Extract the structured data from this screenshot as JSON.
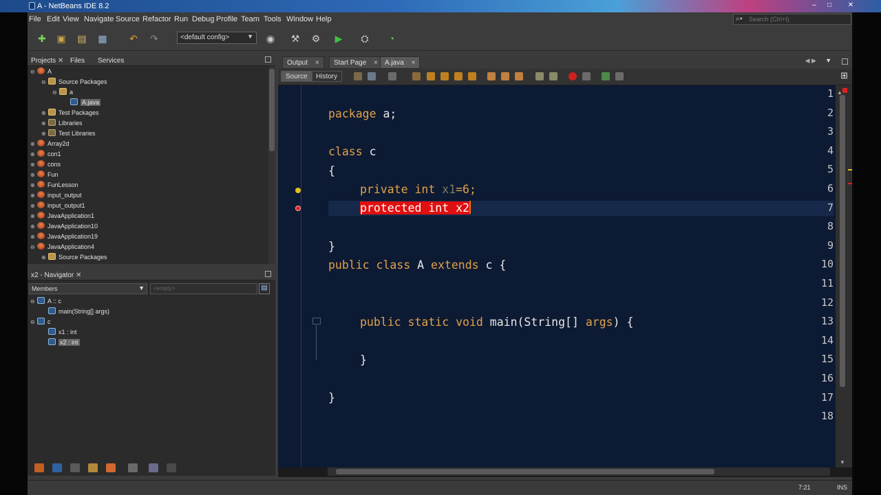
{
  "window": {
    "title": "A - NetBeans IDE 8.2",
    "controls": {
      "minimize": "–",
      "maximize": "□",
      "close": "✕"
    }
  },
  "menubar": {
    "items": [
      "File",
      "Edit",
      "View",
      "Navigate",
      "Source",
      "Refactor",
      "Run",
      "Debug",
      "Profile",
      "Team",
      "Tools",
      "Window",
      "Help"
    ],
    "search_placeholder": "Search (Ctrl+I)"
  },
  "toolbar": {
    "config_select": "<default config>",
    "icons": [
      "new-file-icon",
      "new-project-icon",
      "open-project-icon",
      "save-all-icon",
      "undo-icon",
      "redo-icon",
      "globe-icon",
      "clean-build-icon",
      "build-icon",
      "run-icon",
      "debug-icon",
      "profile-icon"
    ]
  },
  "projects_panel": {
    "tabs": [
      "Projects",
      "Files",
      "Services"
    ],
    "close_glyph": "✕",
    "tree": [
      {
        "label": "A",
        "level": 0,
        "icon": "project-icon",
        "toggle": "⊖"
      },
      {
        "label": "Source Packages",
        "level": 1,
        "icon": "package-folder-icon",
        "toggle": "⊖"
      },
      {
        "label": "a",
        "level": 2,
        "icon": "package-icon",
        "toggle": "⊖"
      },
      {
        "label": "A.java",
        "level": 3,
        "icon": "java-file-icon",
        "toggle": "",
        "selected": true
      },
      {
        "label": "Test Packages",
        "level": 1,
        "icon": "package-folder-icon",
        "toggle": "⊕"
      },
      {
        "label": "Libraries",
        "level": 1,
        "icon": "library-icon",
        "toggle": "⊕"
      },
      {
        "label": "Test Libraries",
        "level": 1,
        "icon": "library-icon",
        "toggle": "⊕"
      },
      {
        "label": "Array2d",
        "level": 0,
        "icon": "project-icon",
        "toggle": "⊕"
      },
      {
        "label": "con1",
        "level": 0,
        "icon": "project-icon",
        "toggle": "⊕"
      },
      {
        "label": "cons",
        "level": 0,
        "icon": "project-icon",
        "toggle": "⊕"
      },
      {
        "label": "Fun",
        "level": 0,
        "icon": "project-icon",
        "toggle": "⊕"
      },
      {
        "label": "FunLesson",
        "level": 0,
        "icon": "project-icon",
        "toggle": "⊕"
      },
      {
        "label": "input_output",
        "level": 0,
        "icon": "project-icon",
        "toggle": "⊕"
      },
      {
        "label": "input_output1",
        "level": 0,
        "icon": "project-icon",
        "toggle": "⊕"
      },
      {
        "label": "JavaApplication1",
        "level": 0,
        "icon": "project-icon",
        "toggle": "⊕"
      },
      {
        "label": "JavaApplication10",
        "level": 0,
        "icon": "project-icon",
        "toggle": "⊕"
      },
      {
        "label": "JavaApplication19",
        "level": 0,
        "icon": "project-icon",
        "toggle": "⊕"
      },
      {
        "label": "JavaApplication4",
        "level": 0,
        "icon": "project-icon",
        "toggle": "⊖"
      },
      {
        "label": "Source Packages",
        "level": 1,
        "icon": "package-folder-icon",
        "toggle": "⊕"
      }
    ]
  },
  "navigator_panel": {
    "title": "x2 - Navigator",
    "members_select": "Members",
    "filter_placeholder": "<empty>",
    "tree": [
      {
        "label": "A :: c",
        "level": 0,
        "toggle": "⊖"
      },
      {
        "label": "main(String[] args)",
        "level": 1,
        "toggle": ""
      },
      {
        "label": "c",
        "level": 0,
        "toggle": "⊖"
      },
      {
        "label": "x1 : int",
        "level": 1,
        "toggle": ""
      },
      {
        "label": "x2 : int",
        "level": 1,
        "toggle": "",
        "selected": true
      }
    ]
  },
  "editor": {
    "tabs": [
      {
        "label": "Output",
        "active": false
      },
      {
        "label": "Start Page",
        "active": false
      },
      {
        "label": "A.java",
        "active": true
      }
    ],
    "close_glyph": "×",
    "view_buttons": [
      "Source",
      "History"
    ],
    "line_numbers": [
      "1",
      "2",
      "3",
      "4",
      "5",
      "6",
      "7",
      "8",
      "9",
      "10",
      "11",
      "12",
      "13",
      "14",
      "15",
      "16",
      "17",
      "18"
    ],
    "lines": {
      "l2_kw": "package",
      "l2_rest": " a;",
      "l4_kw": "class",
      "l4_rest": " c",
      "l5": "{",
      "l6_kw1": "private",
      "l6_kw2": " int",
      "l6_var": " x1",
      "l6_rest": "=6;",
      "l7_err": "protected int x2",
      "l9": "}",
      "l10_kw1": "public",
      "l10_kw2": " class",
      "l10_name": " A ",
      "l10_kw3": "extends",
      "l10_rest": " c {",
      "l13_kw1": "public",
      "l13_kw2": " static",
      "l13_kw3": " void",
      "l13_name": " main(String[] ",
      "l13_arg": "args",
      "l13_rest": ") {",
      "l15": "}",
      "l17": "}"
    }
  },
  "statusbar": {
    "position": "7:21",
    "mode": "INS"
  },
  "colors": {
    "keyword": "#e1a34a",
    "editor_bg": "#0d1a33",
    "error_highlight": "#e01010"
  }
}
